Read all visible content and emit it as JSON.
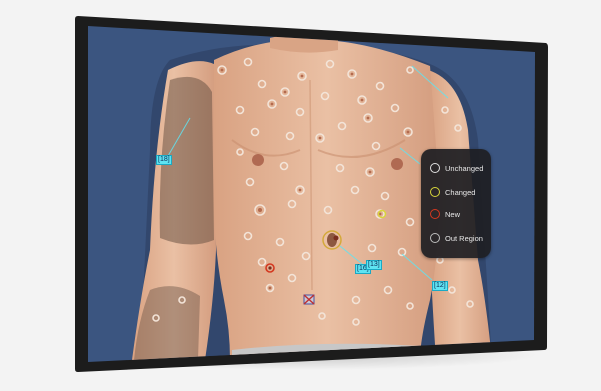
{
  "legend": {
    "items": [
      {
        "label": "Unchanged",
        "color": "#e0e0e0"
      },
      {
        "label": "Changed",
        "color": "#d8d63a"
      },
      {
        "label": "New",
        "color": "#d4371f"
      },
      {
        "label": "Out Region",
        "color": "#bdbdbd"
      }
    ]
  },
  "markers": {
    "left_arm": "[18]",
    "navel_a": "[16]",
    "navel_b": "[13]",
    "right_side": "[12]"
  },
  "colors": {
    "screen_bg": "#3b5580",
    "bezel": "#1c1c1c",
    "skin": "#e5b496",
    "lesion_ring": "#f3e4d8",
    "annotation": "#5fe4f2"
  }
}
